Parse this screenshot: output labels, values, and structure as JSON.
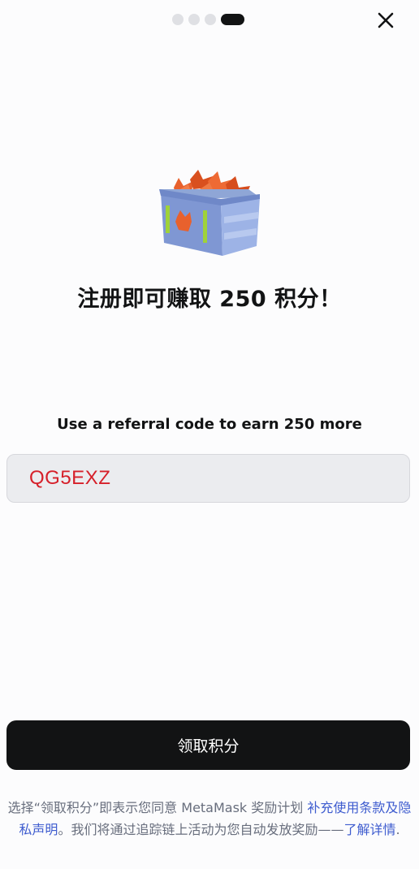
{
  "progress": {
    "total_steps": 4,
    "current_step": 4
  },
  "close_icon": "close-icon",
  "hero_image": "points-crate-image",
  "headline": "注册即可赚取 250 积分！",
  "referral": {
    "label": "Use a referral code to earn 250 more",
    "code_value": "QG5EXZ"
  },
  "claim_button_label": "领取积分",
  "disclaimer": {
    "text_before": "选择“领取积分”即表示您同意 MetaMask 奖励计划 ",
    "terms_link": "补充使用条款及隐私声明",
    "text_middle": "。我们将通过追踪链上活动为您自动发放奖励——",
    "learn_more_link": "了解详情",
    "text_after": "."
  },
  "colors": {
    "background": "#fcfcfd",
    "primary_button": "#121314",
    "link": "#3e5ccf",
    "code_text": "#d6202a",
    "input_background": "#ebecef"
  }
}
